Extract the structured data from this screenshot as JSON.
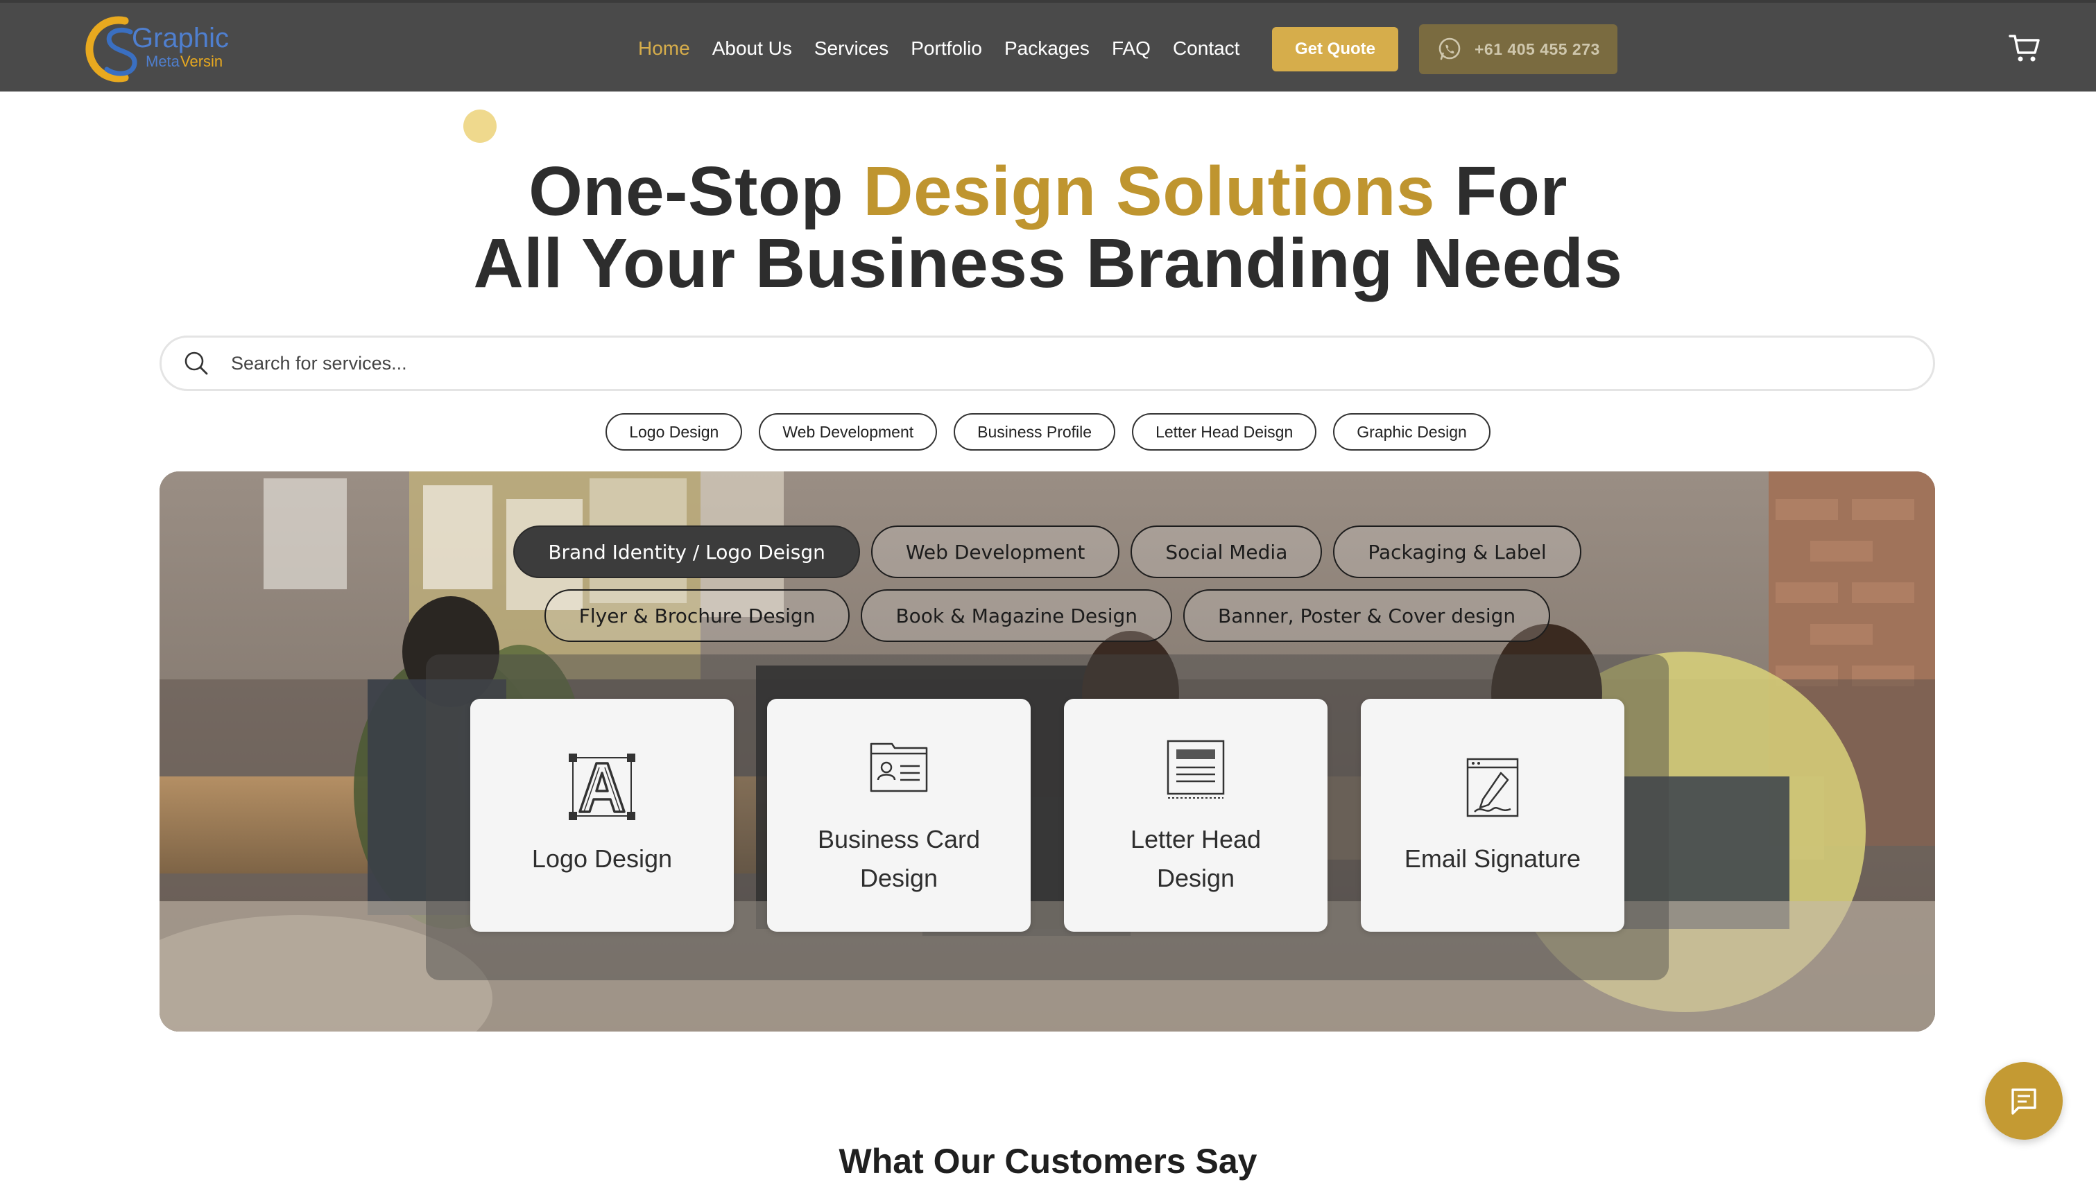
{
  "brand": {
    "logo_text": "Graphic",
    "logo_sub": "Meta Versin",
    "accent_color": "#d6ad4b",
    "nav_bg": "#4a4a4a"
  },
  "nav": {
    "links": [
      {
        "label": "Home",
        "active": true
      },
      {
        "label": "About Us"
      },
      {
        "label": "Services"
      },
      {
        "label": "Portfolio"
      },
      {
        "label": "Packages"
      },
      {
        "label": "FAQ"
      },
      {
        "label": "Contact"
      }
    ],
    "quote_label": "Get Quote",
    "phone": "+61 405 455 273",
    "phone_icon": "whatsapp-icon",
    "cart_icon": "cart-icon"
  },
  "hero": {
    "title_part1": "One-Stop ",
    "title_accent": "Design Solutions",
    "title_part2": " For",
    "title_line2": "All Your Business Branding Needs"
  },
  "search": {
    "placeholder": "Search for services...",
    "value": "",
    "icon": "search-icon"
  },
  "quick_chips": [
    "Logo Design",
    "Web Development",
    "Business Profile",
    "Letter Head Deisgn",
    "Graphic Design"
  ],
  "categories": {
    "row1": [
      "Brand Identity / Logo Deisgn",
      "Web Development",
      "Social Media",
      "Packaging & Label"
    ],
    "row2": [
      "Flyer & Brochure Design",
      "Book & Magazine Design",
      "Banner, Poster & Cover design"
    ],
    "active": "Brand Identity / Logo Deisgn"
  },
  "service_cards": [
    {
      "label": "Logo Design",
      "icon": "logo-letter-icon"
    },
    {
      "label": "Business Card Design",
      "icon": "business-card-icon"
    },
    {
      "label": "Letter Head Design",
      "icon": "letterhead-icon"
    },
    {
      "label": "Email Signature",
      "icon": "signature-icon"
    }
  ],
  "testimonials": {
    "heading": "What Our Customers Say"
  },
  "chat": {
    "icon": "chat-icon"
  }
}
